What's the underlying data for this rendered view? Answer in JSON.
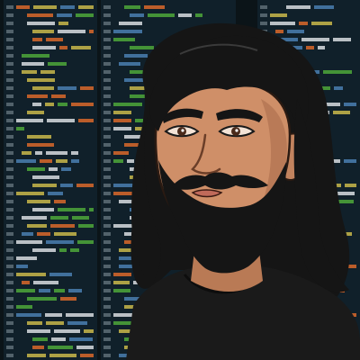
{
  "image": {
    "subject": "avatar-illustration",
    "palette": {
      "background": "#0b1418",
      "monitor_panel": "#10202a",
      "code_green": "#4ea83a",
      "code_orange": "#d9692a",
      "code_yellow": "#c9b84a",
      "code_blue": "#4a7fb0",
      "code_white": "#d8dde0",
      "line_number": "#7e8f98",
      "skin": "#cf8f68",
      "skin_shadow": "#a86a48",
      "hair": "#151515",
      "hair_highlight": "#3a3a3a",
      "shirt": "#1a1a1a",
      "lip": "#c06a5a",
      "eye": "#4a2a1a"
    },
    "icons": [
      "code-editor-background",
      "bearded-man-portrait"
    ]
  }
}
